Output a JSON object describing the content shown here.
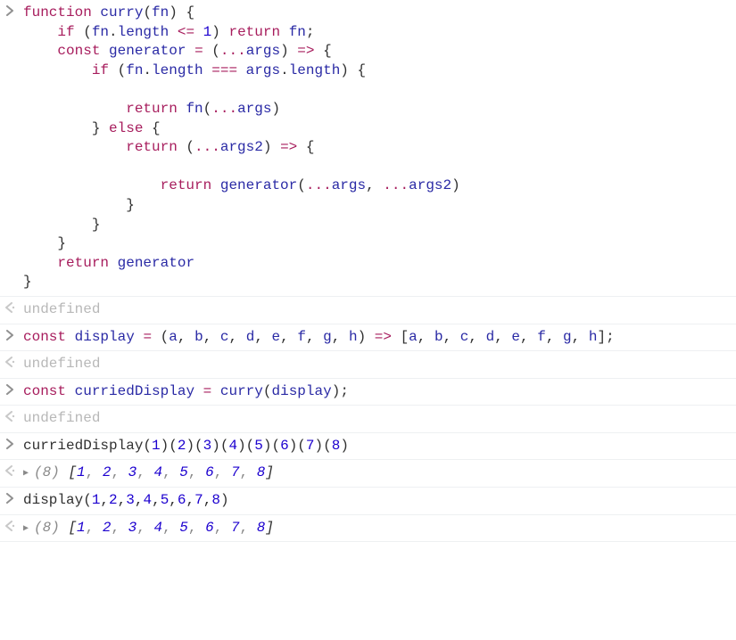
{
  "entries": [
    {
      "type": "input",
      "code": {
        "tokens": [
          {
            "t": "kw",
            "v": "function"
          },
          {
            "t": "p",
            "v": " "
          },
          {
            "t": "fn",
            "v": "curry"
          },
          {
            "t": "p",
            "v": "("
          },
          {
            "t": "fn",
            "v": "fn"
          },
          {
            "t": "p",
            "v": ") {\n    "
          },
          {
            "t": "kw",
            "v": "if"
          },
          {
            "t": "p",
            "v": " ("
          },
          {
            "t": "fn",
            "v": "fn"
          },
          {
            "t": "p",
            "v": "."
          },
          {
            "t": "fn",
            "v": "length"
          },
          {
            "t": "p",
            "v": " "
          },
          {
            "t": "op",
            "v": "<="
          },
          {
            "t": "p",
            "v": " "
          },
          {
            "t": "num",
            "v": "1"
          },
          {
            "t": "p",
            "v": ") "
          },
          {
            "t": "kw",
            "v": "return"
          },
          {
            "t": "p",
            "v": " "
          },
          {
            "t": "fn",
            "v": "fn"
          },
          {
            "t": "p",
            "v": ";\n    "
          },
          {
            "t": "kw",
            "v": "const"
          },
          {
            "t": "p",
            "v": " "
          },
          {
            "t": "fn",
            "v": "generator"
          },
          {
            "t": "p",
            "v": " "
          },
          {
            "t": "op",
            "v": "="
          },
          {
            "t": "p",
            "v": " ("
          },
          {
            "t": "op",
            "v": "..."
          },
          {
            "t": "fn",
            "v": "args"
          },
          {
            "t": "p",
            "v": ") "
          },
          {
            "t": "op",
            "v": "=>"
          },
          {
            "t": "p",
            "v": " {\n        "
          },
          {
            "t": "kw",
            "v": "if"
          },
          {
            "t": "p",
            "v": " ("
          },
          {
            "t": "fn",
            "v": "fn"
          },
          {
            "t": "p",
            "v": "."
          },
          {
            "t": "fn",
            "v": "length"
          },
          {
            "t": "p",
            "v": " "
          },
          {
            "t": "op",
            "v": "==="
          },
          {
            "t": "p",
            "v": " "
          },
          {
            "t": "fn",
            "v": "args"
          },
          {
            "t": "p",
            "v": "."
          },
          {
            "t": "fn",
            "v": "length"
          },
          {
            "t": "p",
            "v": ") {\n\n            "
          },
          {
            "t": "kw",
            "v": "return"
          },
          {
            "t": "p",
            "v": " "
          },
          {
            "t": "fn",
            "v": "fn"
          },
          {
            "t": "p",
            "v": "("
          },
          {
            "t": "op",
            "v": "..."
          },
          {
            "t": "fn",
            "v": "args"
          },
          {
            "t": "p",
            "v": ")\n        } "
          },
          {
            "t": "kw",
            "v": "else"
          },
          {
            "t": "p",
            "v": " {\n            "
          },
          {
            "t": "kw",
            "v": "return"
          },
          {
            "t": "p",
            "v": " ("
          },
          {
            "t": "op",
            "v": "..."
          },
          {
            "t": "fn",
            "v": "args2"
          },
          {
            "t": "p",
            "v": ") "
          },
          {
            "t": "op",
            "v": "=>"
          },
          {
            "t": "p",
            "v": " {\n\n                "
          },
          {
            "t": "kw",
            "v": "return"
          },
          {
            "t": "p",
            "v": " "
          },
          {
            "t": "fn",
            "v": "generator"
          },
          {
            "t": "p",
            "v": "("
          },
          {
            "t": "op",
            "v": "..."
          },
          {
            "t": "fn",
            "v": "args"
          },
          {
            "t": "p",
            "v": ", "
          },
          {
            "t": "op",
            "v": "..."
          },
          {
            "t": "fn",
            "v": "args2"
          },
          {
            "t": "p",
            "v": ")\n            }\n        }\n    }\n    "
          },
          {
            "t": "kw",
            "v": "return"
          },
          {
            "t": "p",
            "v": " "
          },
          {
            "t": "fn",
            "v": "generator"
          },
          {
            "t": "p",
            "v": "\n}"
          }
        ]
      }
    },
    {
      "type": "output",
      "result": "undefined"
    },
    {
      "type": "input",
      "code": {
        "tokens": [
          {
            "t": "kw",
            "v": "const"
          },
          {
            "t": "p",
            "v": " "
          },
          {
            "t": "fn",
            "v": "display"
          },
          {
            "t": "p",
            "v": " "
          },
          {
            "t": "op",
            "v": "="
          },
          {
            "t": "p",
            "v": " ("
          },
          {
            "t": "fn",
            "v": "a"
          },
          {
            "t": "p",
            "v": ", "
          },
          {
            "t": "fn",
            "v": "b"
          },
          {
            "t": "p",
            "v": ", "
          },
          {
            "t": "fn",
            "v": "c"
          },
          {
            "t": "p",
            "v": ", "
          },
          {
            "t": "fn",
            "v": "d"
          },
          {
            "t": "p",
            "v": ", "
          },
          {
            "t": "fn",
            "v": "e"
          },
          {
            "t": "p",
            "v": ", "
          },
          {
            "t": "fn",
            "v": "f"
          },
          {
            "t": "p",
            "v": ", "
          },
          {
            "t": "fn",
            "v": "g"
          },
          {
            "t": "p",
            "v": ", "
          },
          {
            "t": "fn",
            "v": "h"
          },
          {
            "t": "p",
            "v": ") "
          },
          {
            "t": "op",
            "v": "=>"
          },
          {
            "t": "p",
            "v": " ["
          },
          {
            "t": "fn",
            "v": "a"
          },
          {
            "t": "p",
            "v": ", "
          },
          {
            "t": "fn",
            "v": "b"
          },
          {
            "t": "p",
            "v": ", "
          },
          {
            "t": "fn",
            "v": "c"
          },
          {
            "t": "p",
            "v": ", "
          },
          {
            "t": "fn",
            "v": "d"
          },
          {
            "t": "p",
            "v": ", "
          },
          {
            "t": "fn",
            "v": "e"
          },
          {
            "t": "p",
            "v": ", "
          },
          {
            "t": "fn",
            "v": "f"
          },
          {
            "t": "p",
            "v": ", "
          },
          {
            "t": "fn",
            "v": "g"
          },
          {
            "t": "p",
            "v": ", "
          },
          {
            "t": "fn",
            "v": "h"
          },
          {
            "t": "p",
            "v": "];"
          }
        ]
      }
    },
    {
      "type": "output",
      "result": "undefined"
    },
    {
      "type": "input",
      "code": {
        "tokens": [
          {
            "t": "kw",
            "v": "const"
          },
          {
            "t": "p",
            "v": " "
          },
          {
            "t": "fn",
            "v": "curriedDisplay"
          },
          {
            "t": "p",
            "v": " "
          },
          {
            "t": "op",
            "v": "="
          },
          {
            "t": "p",
            "v": " "
          },
          {
            "t": "fn",
            "v": "curry"
          },
          {
            "t": "p",
            "v": "("
          },
          {
            "t": "fn",
            "v": "display"
          },
          {
            "t": "p",
            "v": ");"
          }
        ]
      }
    },
    {
      "type": "output",
      "result": "undefined"
    },
    {
      "type": "input",
      "code": {
        "tokens": [
          {
            "t": "p",
            "v": "curriedDisplay("
          },
          {
            "t": "num",
            "v": "1"
          },
          {
            "t": "p",
            "v": ")("
          },
          {
            "t": "num",
            "v": "2"
          },
          {
            "t": "p",
            "v": ")("
          },
          {
            "t": "num",
            "v": "3"
          },
          {
            "t": "p",
            "v": ")("
          },
          {
            "t": "num",
            "v": "4"
          },
          {
            "t": "p",
            "v": ")("
          },
          {
            "t": "num",
            "v": "5"
          },
          {
            "t": "p",
            "v": ")("
          },
          {
            "t": "num",
            "v": "6"
          },
          {
            "t": "p",
            "v": ")("
          },
          {
            "t": "num",
            "v": "7"
          },
          {
            "t": "p",
            "v": ")("
          },
          {
            "t": "num",
            "v": "8"
          },
          {
            "t": "p",
            "v": ")"
          }
        ]
      }
    },
    {
      "type": "output-array",
      "length": 8,
      "items": [
        1,
        2,
        3,
        4,
        5,
        6,
        7,
        8
      ]
    },
    {
      "type": "input",
      "code": {
        "tokens": [
          {
            "t": "p",
            "v": "display("
          },
          {
            "t": "num",
            "v": "1"
          },
          {
            "t": "p",
            "v": ","
          },
          {
            "t": "num",
            "v": "2"
          },
          {
            "t": "p",
            "v": ","
          },
          {
            "t": "num",
            "v": "3"
          },
          {
            "t": "p",
            "v": ","
          },
          {
            "t": "num",
            "v": "4"
          },
          {
            "t": "p",
            "v": ","
          },
          {
            "t": "num",
            "v": "5"
          },
          {
            "t": "p",
            "v": ","
          },
          {
            "t": "num",
            "v": "6"
          },
          {
            "t": "p",
            "v": ","
          },
          {
            "t": "num",
            "v": "7"
          },
          {
            "t": "p",
            "v": ","
          },
          {
            "t": "num",
            "v": "8"
          },
          {
            "t": "p",
            "v": ")"
          }
        ]
      }
    },
    {
      "type": "output-array",
      "length": 8,
      "items": [
        1,
        2,
        3,
        4,
        5,
        6,
        7,
        8
      ]
    }
  ],
  "colors": {
    "keyword": "#a71d5d",
    "identifier": "#2a2aa5",
    "number": "#1c00cf",
    "muted": "#b8b8b8",
    "border": "#eef0f2"
  }
}
